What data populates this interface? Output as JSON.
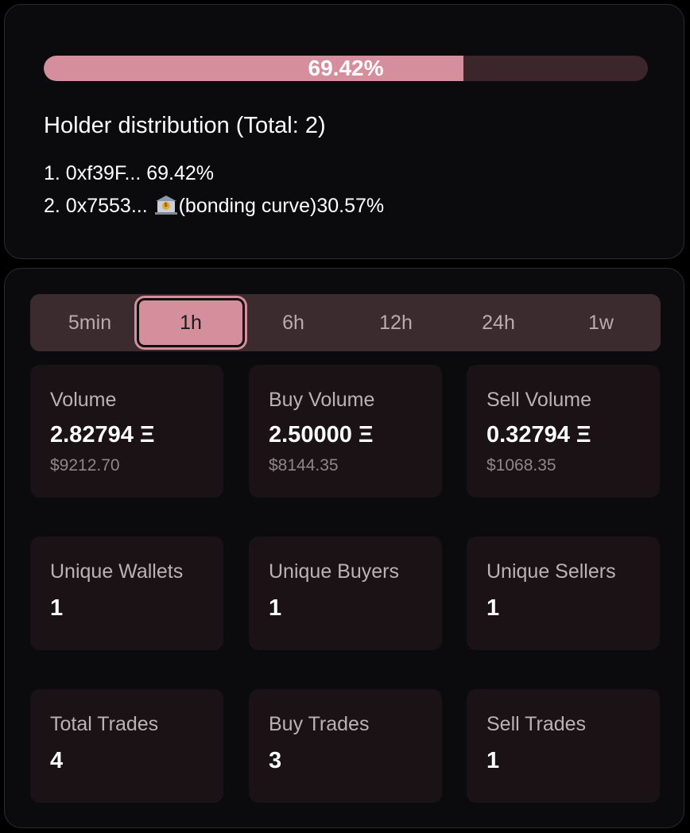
{
  "holders": {
    "top_percent": 69.42,
    "progress_label": "69.42%",
    "title": "Holder distribution (Total: 2)",
    "items": [
      {
        "text": "1. 0xf39F... 69.42%",
        "icon": null
      },
      {
        "prefix": "2. 0x7553...",
        "icon": "bank-icon",
        "suffix": "(bonding curve)30.57%"
      }
    ]
  },
  "timeframes": {
    "tabs": [
      "5min",
      "1h",
      "6h",
      "12h",
      "24h",
      "1w"
    ],
    "active": "1h"
  },
  "stats": {
    "volume": {
      "label": "Volume",
      "value": "2.82794 Ξ",
      "usd": "$9212.70"
    },
    "buy_volume": {
      "label": "Buy Volume",
      "value": "2.50000 Ξ",
      "usd": "$8144.35"
    },
    "sell_volume": {
      "label": "Sell Volume",
      "value": "0.32794 Ξ",
      "usd": "$1068.35"
    },
    "unique_wallets": {
      "label": "Unique Wallets",
      "value": "1"
    },
    "unique_buyers": {
      "label": "Unique Buyers",
      "value": "1"
    },
    "unique_sellers": {
      "label": "Unique Sellers",
      "value": "1"
    },
    "total_trades": {
      "label": "Total Trades",
      "value": "4"
    },
    "buy_trades": {
      "label": "Buy Trades",
      "value": "3"
    },
    "sell_trades": {
      "label": "Sell Trades",
      "value": "1"
    }
  },
  "colors": {
    "accent": "#d58e9b",
    "track": "#3a262b",
    "tile": "#1a1214",
    "tabbar": "#3b2a2e"
  }
}
